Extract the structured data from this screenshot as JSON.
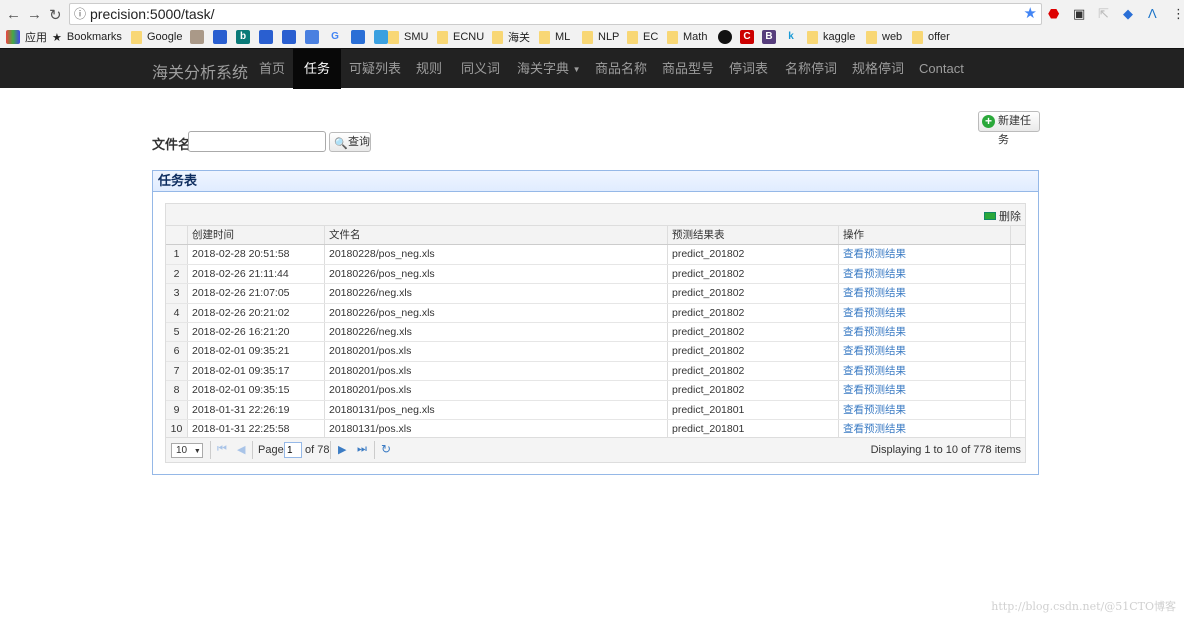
{
  "browser": {
    "url": "precision:5000/task/",
    "bookmarks": [
      "应用",
      "Bookmarks",
      "Google",
      "SMU",
      "ECNU",
      "海关",
      "ML",
      "NLP",
      "EC",
      "Math",
      "kaggle",
      "web",
      "offer"
    ]
  },
  "navbar": {
    "brand": "海关分析系统",
    "items": [
      {
        "label": "首页"
      },
      {
        "label": "任务",
        "active": true
      },
      {
        "label": "可疑列表"
      },
      {
        "label": "规则"
      },
      {
        "label": "同义词"
      },
      {
        "label": "海关字典",
        "dropdown": true
      },
      {
        "label": "商品名称"
      },
      {
        "label": "商品型号"
      },
      {
        "label": "停词表"
      },
      {
        "label": "名称停词"
      },
      {
        "label": "规格停词"
      },
      {
        "label": "Contact"
      }
    ]
  },
  "toolbar": {
    "new_task": "新建任务"
  },
  "search": {
    "label": "文件名",
    "value": "",
    "button": "查询"
  },
  "panel": {
    "title": "任务表",
    "delete": "删除",
    "columns": [
      "创建时间",
      "文件名",
      "预测结果表",
      "操作"
    ],
    "rows": [
      [
        "1",
        "2018-02-28 20:51:58",
        "20180228/pos_neg.xls",
        "predict_201802",
        "查看预测结果"
      ],
      [
        "2",
        "2018-02-26 21:11:44",
        "20180226/pos_neg.xls",
        "predict_201802",
        "查看预测结果"
      ],
      [
        "3",
        "2018-02-26 21:07:05",
        "20180226/neg.xls",
        "predict_201802",
        "查看预测结果"
      ],
      [
        "4",
        "2018-02-26 20:21:02",
        "20180226/pos_neg.xls",
        "predict_201802",
        "查看预测结果"
      ],
      [
        "5",
        "2018-02-26 16:21:20",
        "20180226/neg.xls",
        "predict_201802",
        "查看预测结果"
      ],
      [
        "6",
        "2018-02-01 09:35:21",
        "20180201/pos.xls",
        "predict_201802",
        "查看预测结果"
      ],
      [
        "7",
        "2018-02-01 09:35:17",
        "20180201/pos.xls",
        "predict_201802",
        "查看预测结果"
      ],
      [
        "8",
        "2018-02-01 09:35:15",
        "20180201/pos.xls",
        "predict_201802",
        "查看预测结果"
      ],
      [
        "9",
        "2018-01-31 22:26:19",
        "20180131/pos_neg.xls",
        "predict_201801",
        "查看预测结果"
      ],
      [
        "10",
        "2018-01-31 22:25:58",
        "20180131/pos.xls",
        "predict_201801",
        "查看预测结果"
      ]
    ]
  },
  "pager": {
    "page_size": "10",
    "page_label": "Page",
    "page": "1",
    "of": "of 78",
    "info": "Displaying 1 to 10 of 778 items"
  },
  "watermark": "http://blog.csdn.net/@51CTO博客"
}
